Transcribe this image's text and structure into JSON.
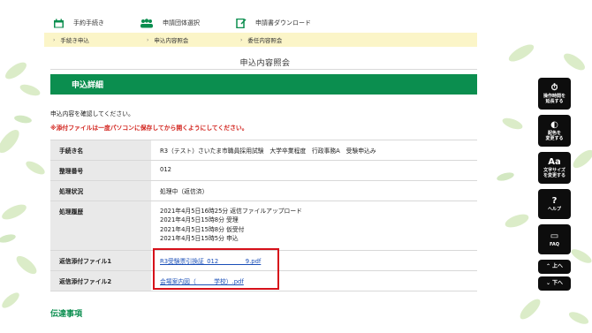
{
  "topnav": [
    {
      "label": "手約手続き",
      "icon": "calendar-icon"
    },
    {
      "label": "申請団体選択",
      "icon": "group-icon"
    },
    {
      "label": "申請書ダウンロード",
      "icon": "document-icon"
    }
  ],
  "breadcrumb": [
    "手続き申込",
    "申込内容照会",
    "委任内容照会"
  ],
  "page_title": "申込内容照会",
  "section_title": "申込詳細",
  "intro": "申込内容を確認してください。",
  "warning": "※添付ファイルは一度パソコンに保存してから開くようにしてください。",
  "rows": {
    "procedure_label": "手続き名",
    "procedure_value": "R3（テスト）さいたま市職員採用試験　大学卒業程度　行政事務A　受験申込み",
    "number_label": "整理番号",
    "number_value": "012",
    "status_label": "処理状況",
    "status_value": "処理中（返信済）",
    "history_label": "処理履歴",
    "history": [
      "2021年4月5日16時25分 返信ファイルアップロード",
      "2021年4月5日15時8分 受理",
      "2021年4月5日15時8分 仮受付",
      "2021年4月5日15時5分 申込"
    ],
    "file1_label": "返信添付ファイル1",
    "file1_link": "R3受験票引換証_012_　　　　9.pdf",
    "file2_label": "返信添付ファイル2",
    "file2_link": "会場案内図（　　　学校）.pdf"
  },
  "footer_title": "伝達事項",
  "sidebar": {
    "time_extend": [
      "操作時間を",
      "延長する"
    ],
    "color_change": [
      "配色を",
      "変更する"
    ],
    "font_size": [
      "文字サイズ",
      "を変更する"
    ],
    "help": "ヘルプ",
    "faq": "FAQ",
    "up": "上へ",
    "down": "下へ"
  },
  "colors": {
    "green": "#0b8e4f",
    "highlight_red": "#d6101a",
    "warning_red": "#d2231d",
    "breadcrumb_bg": "#fbf5c8"
  }
}
